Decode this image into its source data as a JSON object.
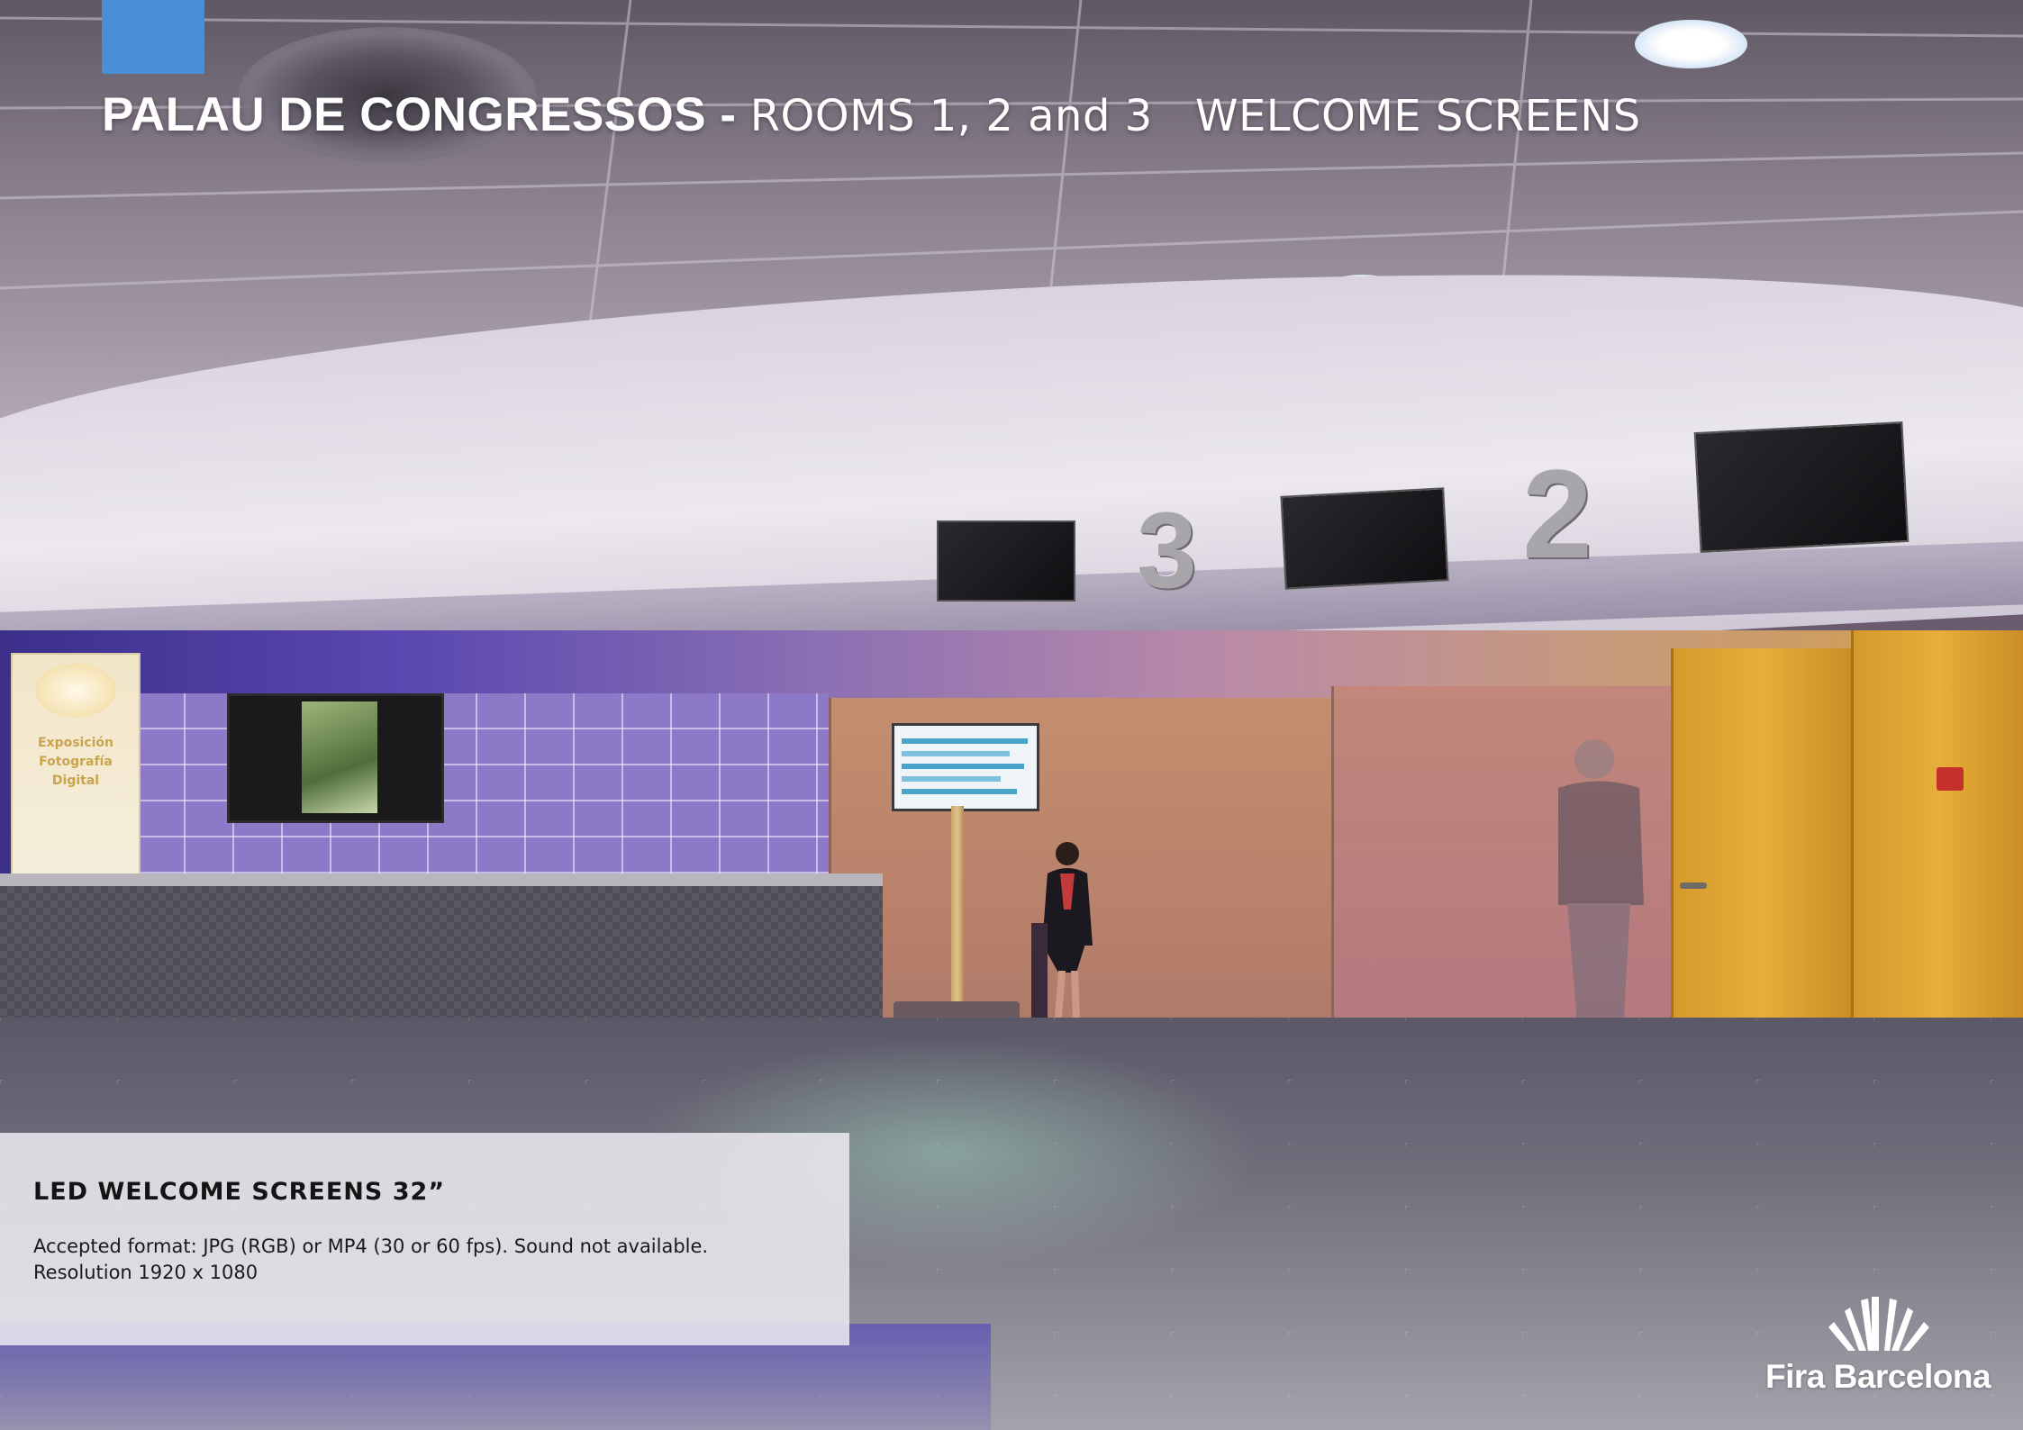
{
  "header": {
    "title_bold": "PALAU DE CONGRESSOS -",
    "title_rest": "ROOMS 1, 2 and 3   WELCOME SCREENS",
    "accent_color": "#4a8ed6"
  },
  "scene": {
    "room_numbers": [
      "3",
      "2"
    ],
    "banner_text": [
      "Exposición",
      "Fotografía",
      "Digital"
    ]
  },
  "info_panel": {
    "heading": "LED WELCOME SCREENS 32”",
    "line_1": "Accepted format: JPG (RGB) or MP4 (30 or 60 fps). Sound not available.",
    "line_2": "Resolution 1920 x 1080"
  },
  "logo": {
    "text": "Fira Barcelona",
    "icon": "fira-barcelona-logo-icon"
  }
}
